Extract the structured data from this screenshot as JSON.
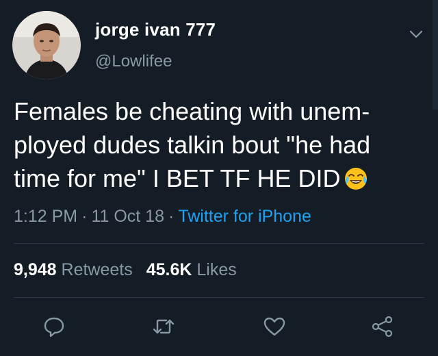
{
  "author": {
    "display_name": "jorge ivan 777",
    "handle": "@Lowlifee"
  },
  "tweet": {
    "lines": [
      "Females be cheating with unem-",
      "ployed dudes talkin bout \"he had",
      "time for me\" I BET TF HE DID"
    ],
    "emoji": "face-with-tears-of-joy",
    "time": "1:12 PM",
    "separator": "·",
    "date": "11 Oct 18",
    "source": "Twitter for iPhone"
  },
  "stats": {
    "retweets_count": "9,948",
    "retweets_label": "Retweets",
    "likes_count": "45.6K",
    "likes_label": "Likes"
  },
  "actions": [
    "reply-icon",
    "retweet-icon",
    "like-icon",
    "share-icon"
  ],
  "colors": {
    "background": "#141d26",
    "text": "#ffffff",
    "secondary": "#8899a6",
    "link": "#1da1f2",
    "divider": "#2b3a4a"
  }
}
